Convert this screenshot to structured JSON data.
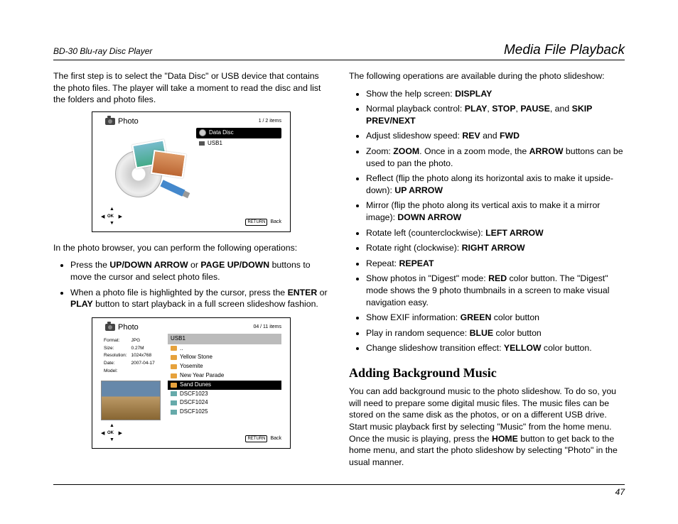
{
  "header": {
    "left": "BD-30 Blu-ray Disc Player",
    "right": "Media File Playback"
  },
  "page_number": "47",
  "left_col": {
    "intro": "The first step is to select the \"Data Disc\" or USB device that contains the photo files. The player will take a moment to read the disc and list the folders and photo files.",
    "shot1": {
      "title": "Photo",
      "count": "1 / 2 items",
      "items": [
        "Data Disc",
        "USB1"
      ],
      "ok": "OK",
      "return_btn": "RETURN",
      "return_lbl": "Back"
    },
    "browser_intro": "In the photo browser, you can perform the following operations:",
    "browser_ops": [
      {
        "pre": "Press the ",
        "b": "UP/DOWN ARROW",
        "mid": " or ",
        "b2": "PAGE UP/DOWN",
        "post": " buttons to move the cursor and select photo files."
      },
      {
        "pre": "When a photo file is highlighted by the cursor, press the ",
        "b": "ENTER",
        "mid": " or ",
        "b2": "PLAY",
        "post": " button to start playback in a full screen slideshow fashion."
      }
    ],
    "shot2": {
      "title": "Photo",
      "count": "04 / 11 items",
      "meta": {
        "Format": "JPG",
        "Size": "0.27M",
        "Resolution": "1024x768",
        "Date": "2007-04-17",
        "Model": ""
      },
      "list_head": "USB1",
      "rows": [
        {
          "type": "up",
          "label": ".."
        },
        {
          "type": "folder",
          "label": "Yellow Stone"
        },
        {
          "type": "folder",
          "label": "Yosemite"
        },
        {
          "type": "folder",
          "label": "New Year Parade"
        },
        {
          "type": "folder",
          "label": "Sand Dunes",
          "sel": true
        },
        {
          "type": "img",
          "label": "DSCF1023"
        },
        {
          "type": "img",
          "label": "DSCF1024"
        },
        {
          "type": "img",
          "label": "DSCF1025"
        }
      ],
      "ok": "OK",
      "return_btn": "RETURN",
      "return_lbl": "Back"
    }
  },
  "right_col": {
    "intro": "The following operations are available during the photo slideshow:",
    "ops": [
      {
        "text": "Show the help screen: ",
        "bold": "DISPLAY"
      },
      {
        "text": "Normal playback control: ",
        "bold": "PLAY",
        "text2": ", ",
        "bold2": "STOP",
        "text3": ", ",
        "bold3": "PAUSE",
        "text4": ", and ",
        "bold4": "SKIP PREV/NEXT"
      },
      {
        "text": "Adjust slideshow speed: ",
        "bold": "REV",
        "text2": " and ",
        "bold2": "FWD"
      },
      {
        "text": "Zoom: ",
        "bold": "ZOOM",
        "text2": ". Once in a zoom mode, the ",
        "bold2": "ARROW",
        "text3": " buttons can be used to pan the photo."
      },
      {
        "text": "Reflect (flip the photo along its horizontal axis to make it upside-down): ",
        "bold": "UP ARROW"
      },
      {
        "text": "Mirror (flip the photo along its vertical axis to make it a mirror image): ",
        "bold": "DOWN ARROW"
      },
      {
        "text": "Rotate left (counterclockwise): ",
        "bold": "LEFT ARROW"
      },
      {
        "text": "Rotate right (clockwise): ",
        "bold": "RIGHT ARROW"
      },
      {
        "text": "Repeat: ",
        "bold": "REPEAT"
      },
      {
        "text": "Show photos in \"Digest\" mode: ",
        "bold": "RED",
        "text2": " color button. The \"Digest\" mode shows the 9 photo thumbnails in a screen to make visual navigation easy."
      },
      {
        "text": "Show EXIF information: ",
        "bold": "GREEN",
        "text2": " color button"
      },
      {
        "text": "Play in random sequence: ",
        "bold": "BLUE",
        "text2": " color button"
      },
      {
        "text": "Change slideshow transition effect: ",
        "bold": "YELLOW",
        "text2": " color button."
      }
    ],
    "h2": "Adding Background Music",
    "bg_para_pre": "You can add background music to the photo slideshow. To do so, you will need to prepare some digital music files. The music files can be stored on the same disk as the photos, or on a different USB drive. Start music playback first by selecting \"Music\" from the home menu. Once the music is playing, press the ",
    "bg_bold": "HOME",
    "bg_para_post": " button to get back to the home menu, and start the photo slideshow by selecting \"Photo\" in the usual manner."
  }
}
